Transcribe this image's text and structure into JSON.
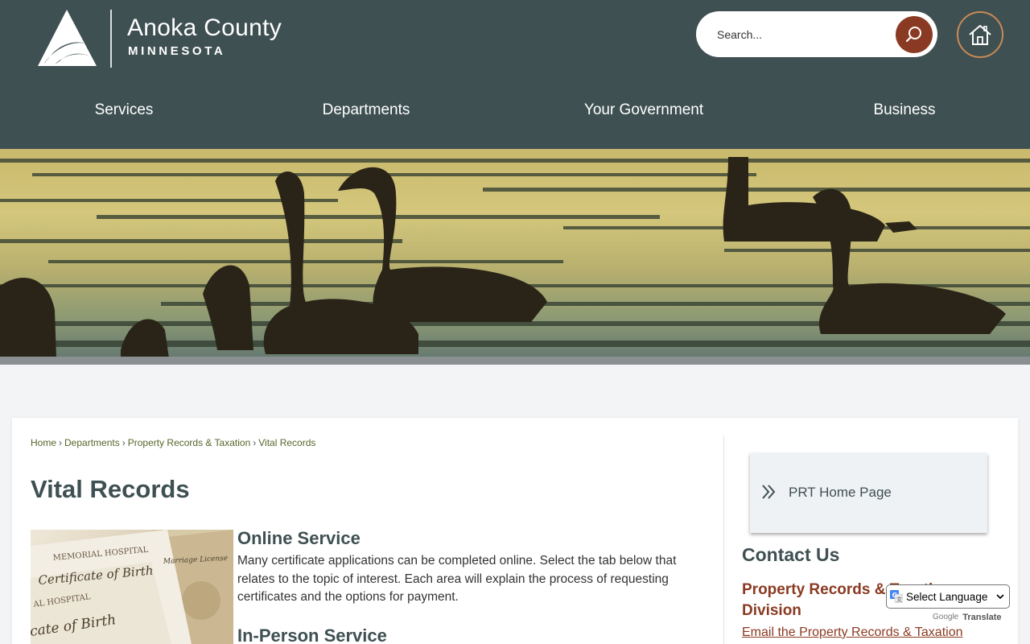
{
  "header": {
    "logo": {
      "name": "Anoka County",
      "state": "MINNESOTA"
    },
    "search": {
      "placeholder": "Search..."
    },
    "nav": [
      {
        "label": "Services"
      },
      {
        "label": "Departments"
      },
      {
        "label": "Your Government"
      },
      {
        "label": "Business"
      }
    ]
  },
  "breadcrumb": [
    {
      "label": "Home"
    },
    {
      "label": "Departments"
    },
    {
      "label": "Property Records & Taxation"
    },
    {
      "label": "Vital Records"
    }
  ],
  "main": {
    "title": "Vital Records",
    "image_text": {
      "hospital": "MEMORIAL HOSPITAL",
      "cert": "Certificate of Birth",
      "license": "Marriage License",
      "hospital2": "AL HOSPITAL",
      "cert2": "cate of Birth"
    },
    "sections": [
      {
        "heading": "Online Service",
        "text": "Many certificate applications can be completed online. Select the tab below that relates to the topic of interest. Each area will explain the process of requesting certificates and the options for payment."
      },
      {
        "heading": "In-Person Service"
      }
    ]
  },
  "sidebar": {
    "prt_link": "PRT Home Page",
    "contact_heading": "Contact Us",
    "division": "Property Records & Taxation Division",
    "email_link": "Email the Property Records & Taxation"
  },
  "translate": {
    "select_label": "Select Language",
    "powered_google": "Google",
    "powered_translate": "Translate"
  },
  "colors": {
    "header_bg": "#3f5052",
    "accent_rust": "#8a3a22",
    "home_ring": "#c98a55",
    "breadcrumb_link": "#55662a"
  }
}
